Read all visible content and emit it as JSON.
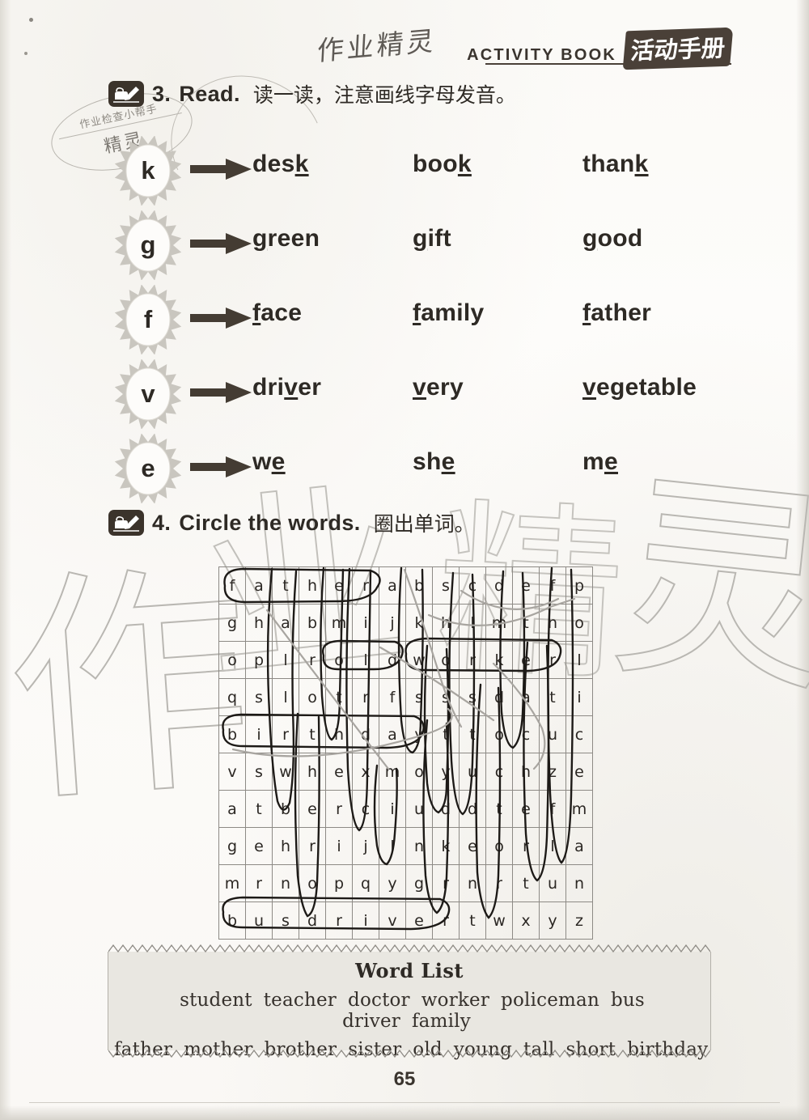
{
  "header": {
    "english": "ACTIVITY BOOK",
    "chinese": "活动手册"
  },
  "watermarks": {
    "handwritten": "作业精灵",
    "big_left": "作",
    "big_mid_left": "业",
    "big_mid_right": "精",
    "big_right": "灵",
    "stamp_line1": "作业检查小帮手",
    "stamp_line2": "精灵"
  },
  "exercise3": {
    "number": "3.",
    "title": "Read.",
    "chinese": "读一读，注意画线字母发音。",
    "icon": "hand-pencil-icon",
    "rows": [
      {
        "letter": "k",
        "words": [
          {
            "pre": "des",
            "mark": "k",
            "post": ""
          },
          {
            "pre": "boo",
            "mark": "k",
            "post": ""
          },
          {
            "pre": "than",
            "mark": "k",
            "post": ""
          }
        ]
      },
      {
        "letter": "g",
        "words": [
          {
            "pre": "",
            "mark": "g",
            "post": "reen"
          },
          {
            "pre": "",
            "mark": "g",
            "post": "ift"
          },
          {
            "pre": "",
            "mark": "g",
            "post": "ood"
          }
        ]
      },
      {
        "letter": "f",
        "words": [
          {
            "pre": "",
            "mark": "f",
            "post": "ace"
          },
          {
            "pre": "",
            "mark": "f",
            "post": "amily"
          },
          {
            "pre": "",
            "mark": "f",
            "post": "ather"
          }
        ]
      },
      {
        "letter": "v",
        "words": [
          {
            "pre": "dri",
            "mark": "v",
            "post": "er"
          },
          {
            "pre": "",
            "mark": "v",
            "post": "ery"
          },
          {
            "pre": "",
            "mark": "v",
            "post": "egetable"
          }
        ]
      },
      {
        "letter": "e",
        "words": [
          {
            "pre": "w",
            "mark": "e",
            "post": ""
          },
          {
            "pre": "sh",
            "mark": "e",
            "post": ""
          },
          {
            "pre": "m",
            "mark": "e",
            "post": ""
          }
        ]
      }
    ]
  },
  "exercise4": {
    "number": "4.",
    "title": "Circle the words.",
    "chinese": "圈出单词。",
    "icon": "hand-pencil-icon",
    "grid": [
      [
        "f",
        "a",
        "t",
        "h",
        "e",
        "r",
        "a",
        "b",
        "s",
        "c",
        "d",
        "e",
        "f",
        "p"
      ],
      [
        "g",
        "h",
        "a",
        "b",
        "m",
        "i",
        "j",
        "k",
        "h",
        "l",
        "m",
        "t",
        "n",
        "o"
      ],
      [
        "o",
        "p",
        "l",
        "r",
        "o",
        "l",
        "d",
        "w",
        "o",
        "r",
        "k",
        "e",
        "r",
        "l"
      ],
      [
        "q",
        "s",
        "l",
        "o",
        "t",
        "r",
        "f",
        "s",
        "s",
        "s",
        "d",
        "a",
        "t",
        "i"
      ],
      [
        "b",
        "i",
        "r",
        "t",
        "h",
        "d",
        "a",
        "y",
        "t",
        "t",
        "o",
        "c",
        "u",
        "c"
      ],
      [
        "v",
        "s",
        "w",
        "h",
        "e",
        "x",
        "m",
        "o",
        "y",
        "u",
        "c",
        "h",
        "z",
        "e"
      ],
      [
        "a",
        "t",
        "b",
        "e",
        "r",
        "c",
        "i",
        "u",
        "d",
        "d",
        "t",
        "e",
        "f",
        "m"
      ],
      [
        "g",
        "e",
        "h",
        "r",
        "i",
        "j",
        "l",
        "n",
        "k",
        "e",
        "o",
        "r",
        "l",
        "a"
      ],
      [
        "m",
        "r",
        "n",
        "o",
        "p",
        "q",
        "y",
        "g",
        "r",
        "n",
        "r",
        "t",
        "u",
        "n"
      ],
      [
        "b",
        "u",
        "s",
        "d",
        "r",
        "i",
        "v",
        "e",
        "r",
        "t",
        "w",
        "x",
        "y",
        "z"
      ]
    ]
  },
  "wordlist": {
    "title": "Word List",
    "row1": [
      "student",
      "teacher",
      "doctor",
      "worker",
      "policeman",
      "bus driver",
      "family"
    ],
    "row2": [
      "father",
      "mother",
      "brother",
      "sister",
      "old",
      "young",
      "tall",
      "short",
      "birthday"
    ]
  },
  "page_number": "65",
  "colors": {
    "ink": "#2e2a25",
    "paper": "#fdfcfa",
    "banner": "#4a4038",
    "pencil": "#1d1a17",
    "watermark": "#b9b7b2"
  }
}
